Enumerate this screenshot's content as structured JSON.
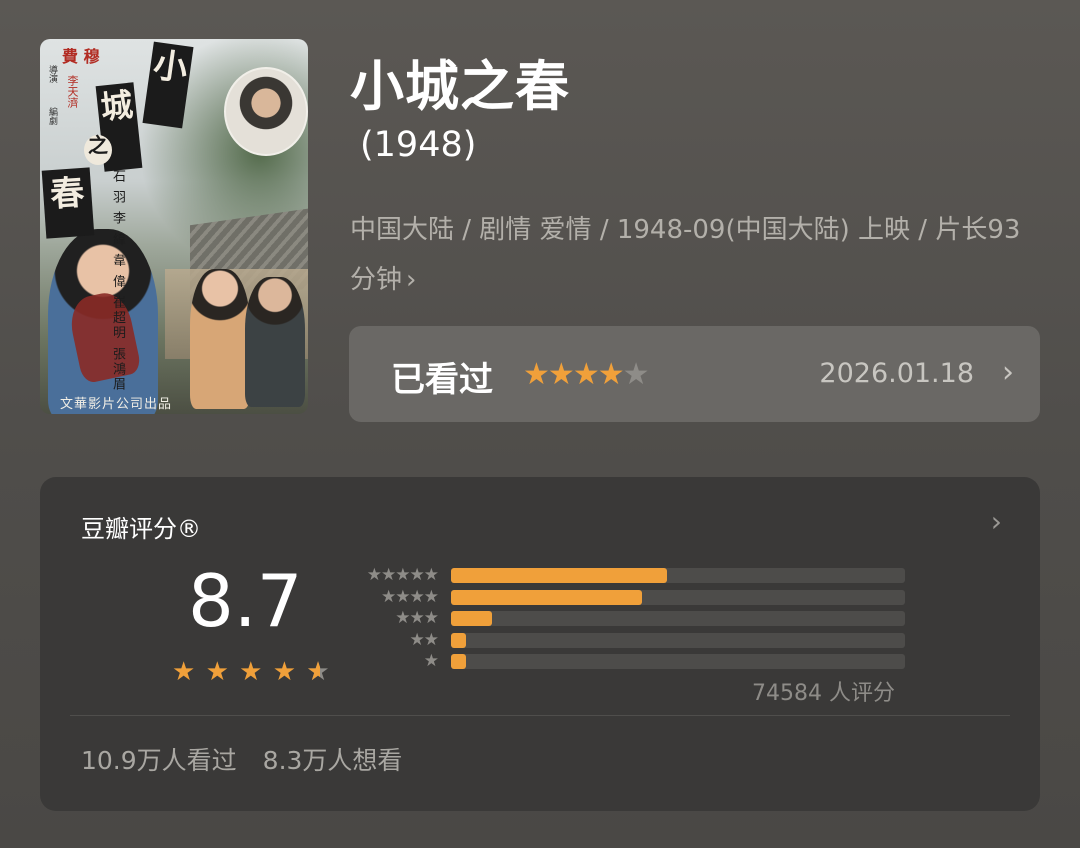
{
  "movie": {
    "title": "小城之春",
    "year": "(1948)",
    "meta": "中国大陆 / 剧情 爱情 / 1948-09(中国大陆) 上映 / 片长93分钟",
    "meta_chevron": "chevron-right-icon"
  },
  "poster": {
    "title_chars": [
      "小",
      "城",
      "之",
      "春"
    ],
    "credit_top": "費 穆",
    "credit_director": "導演",
    "credit_writer": "李天濟",
    "credit_writer_role": "編劇",
    "cast": "石 羽 李 緯 韋 偉 崔超明 張鴻眉",
    "studio": "文華影片公司出品"
  },
  "watched": {
    "label": "已看过",
    "rating": 4,
    "max_rating": 5,
    "date": "2026.01.18",
    "chevron": "chevron-right-icon"
  },
  "rating_card": {
    "title": "豆瓣评分®",
    "chevron": "chevron-right-icon",
    "score": "8.7",
    "score_stars": 4.5,
    "distribution": [
      {
        "stars": 5,
        "label": "★★★★★",
        "percent": 47.6
      },
      {
        "stars": 4,
        "label": "★★★★",
        "percent": 42.0
      },
      {
        "stars": 3,
        "label": "★★★",
        "percent": 9.0
      },
      {
        "stars": 2,
        "label": "★★",
        "percent": 1.0
      },
      {
        "stars": 1,
        "label": "★",
        "percent": 0.4
      }
    ],
    "total_ratings": "74584 人评分",
    "watched_count": "10.9万人看过",
    "wish_count": "8.3万人想看"
  },
  "colors": {
    "accent": "#f0a03a",
    "star_inactive": "#8e8c88",
    "card_bg": "#3a3938",
    "watched_bg": "#6a6865"
  }
}
